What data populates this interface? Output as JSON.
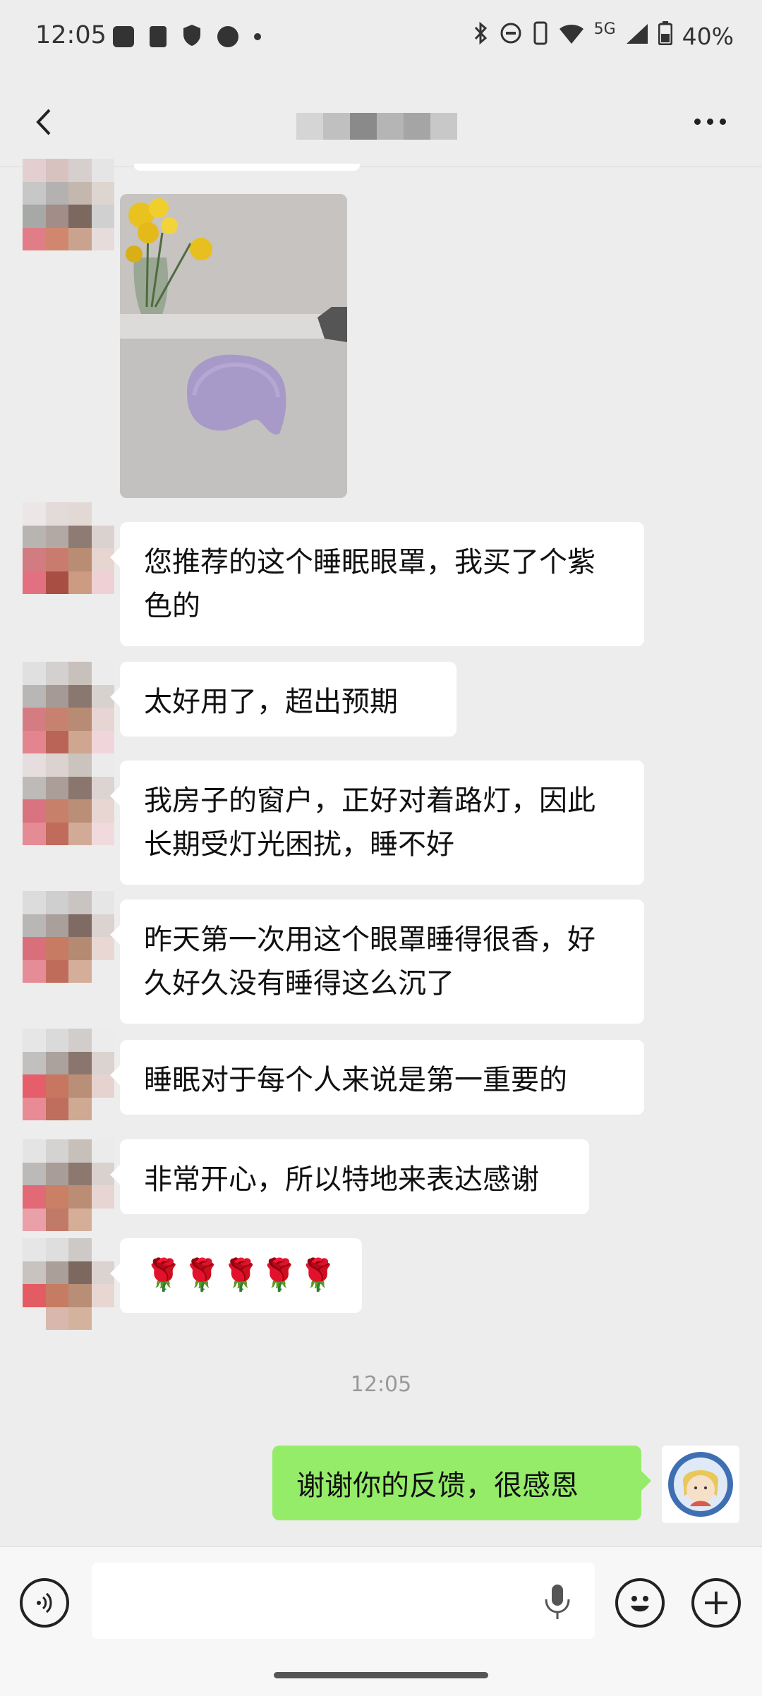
{
  "status_bar": {
    "time": "12:05",
    "network": "5G",
    "battery": "40%",
    "icons": [
      "mail-icon",
      "phone-link-icon",
      "shield-icon",
      "calendar-icon",
      "dot-icon",
      "bluetooth-icon",
      "dnd-icon",
      "vibrate-icon",
      "wifi-icon",
      "signal-icon",
      "battery-icon"
    ]
  },
  "title_bar": {
    "back_icon": "back-arrow-icon",
    "more_icon": "more-dots-icon"
  },
  "messages": [
    {
      "type": "image",
      "sender": "other",
      "image_desc": "photo-yellow-flowers-purple-eye-mask"
    },
    {
      "type": "text",
      "sender": "other",
      "text": "您推荐的这个睡眠眼罩，我买了个紫色的"
    },
    {
      "type": "text",
      "sender": "other",
      "text": "太好用了，超出预期"
    },
    {
      "type": "text",
      "sender": "other",
      "text": "我房子的窗户，正好对着路灯，因此长期受灯光困扰，睡不好"
    },
    {
      "type": "text",
      "sender": "other",
      "text": "昨天第一次用这个眼罩睡得很香，好久好久没有睡得这么沉了"
    },
    {
      "type": "text",
      "sender": "other",
      "text": "睡眠对于每个人来说是第一重要的"
    },
    {
      "type": "text",
      "sender": "other",
      "text": "非常开心，所以特地来表达感谢"
    },
    {
      "type": "text",
      "sender": "other",
      "text": "🌹🌹🌹🌹🌹"
    },
    {
      "type": "time",
      "text": "12:05"
    },
    {
      "type": "text",
      "sender": "me",
      "text": "谢谢你的反馈，很感恩"
    }
  ],
  "input_bar": {
    "voice_icon": "voice-icon",
    "mic_icon": "microphone-icon",
    "emoji_icon": "emoji-icon",
    "plus_icon": "plus-icon"
  },
  "colors": {
    "background": "#ededed",
    "my_bubble": "#95ec69",
    "other_bubble": "#ffffff"
  }
}
